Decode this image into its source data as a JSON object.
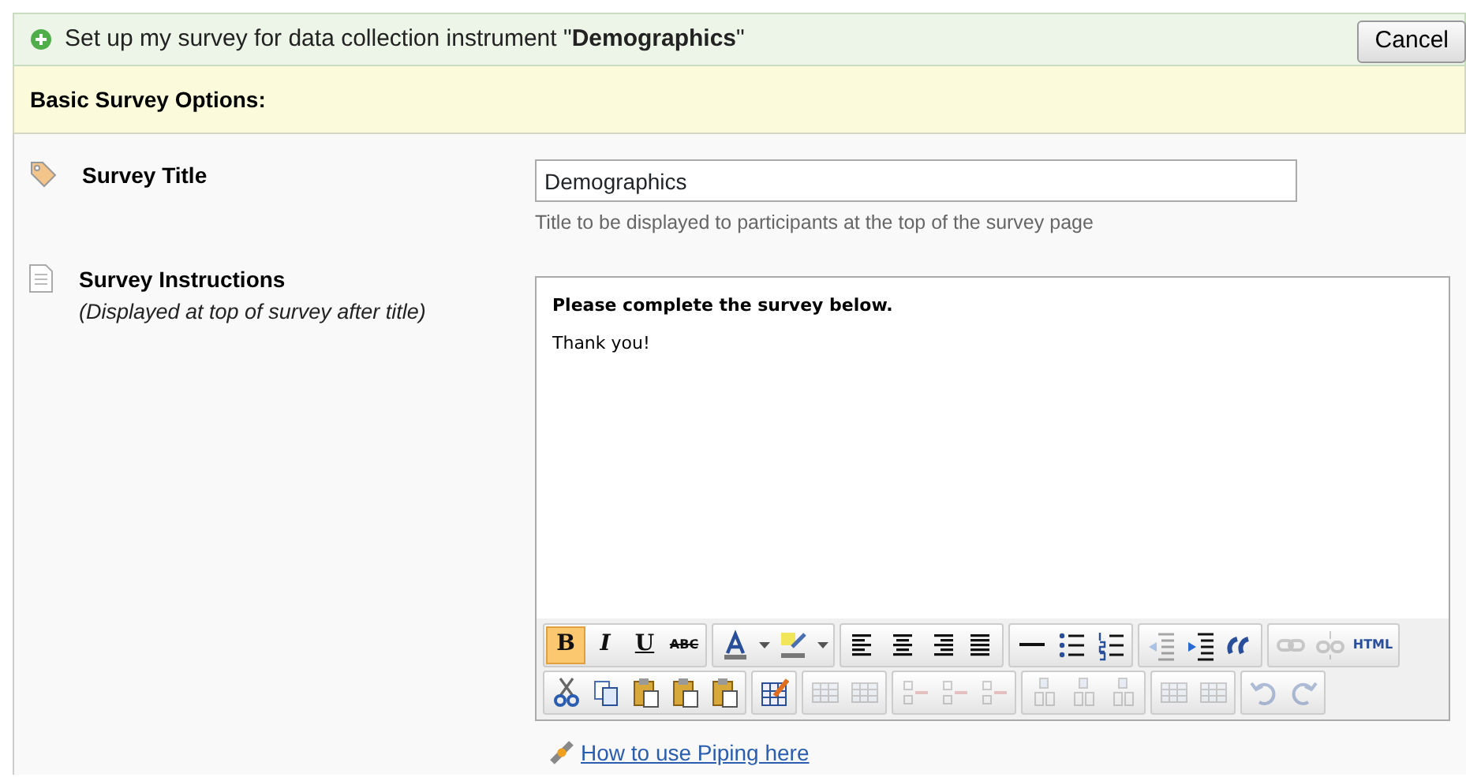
{
  "header": {
    "title": "Set up my survey for data collection instrument \"**Demographics**\"",
    "cancel": "Cancel"
  },
  "section": {
    "title": "Basic Survey Options:"
  },
  "fields": [
    {
      "kind": "text",
      "label": "Survey Title",
      "value": "Demographics",
      "hint": "Title to be displayed to participants at the top of the survey page"
    },
    {
      "kind": "editor",
      "label": "Survey Instructions",
      "sublabel": "(Displayed at top of survey after title)",
      "content": [
        {
          "kind": "heading",
          "text": "Please complete the survey below."
        },
        {
          "kind": "para",
          "text": "Thank you!"
        }
      ],
      "toolbar": [
        [
          [
            {
              "kind": "bold",
              "label": "B",
              "active": true,
              "disabled": false
            },
            {
              "kind": "italic",
              "label": "I",
              "active": false,
              "disabled": false
            },
            {
              "kind": "underline",
              "label": "U",
              "active": false,
              "disabled": false
            },
            {
              "kind": "strike",
              "label": "ABC",
              "active": false,
              "disabled": false
            }
          ],
          [
            {
              "kind": "textcolor",
              "active": false,
              "disabled": false
            },
            {
              "kind": "caret",
              "active": false,
              "disabled": false
            },
            {
              "kind": "highlight",
              "active": false,
              "disabled": false
            },
            {
              "kind": "caret",
              "active": false,
              "disabled": false
            }
          ],
          [
            {
              "kind": "align-left",
              "active": false,
              "disabled": false
            },
            {
              "kind": "align-center",
              "active": false,
              "disabled": false
            },
            {
              "kind": "align-right",
              "active": false,
              "disabled": false
            },
            {
              "kind": "justify",
              "active": false,
              "disabled": false
            }
          ],
          [
            {
              "kind": "rule",
              "active": false,
              "disabled": false
            },
            {
              "kind": "bullets",
              "active": false,
              "disabled": false
            },
            {
              "kind": "numbers",
              "active": false,
              "disabled": false
            }
          ],
          [
            {
              "kind": "outdent",
              "active": false,
              "disabled": true
            },
            {
              "kind": "indent",
              "active": false,
              "disabled": false
            },
            {
              "kind": "quote",
              "active": false,
              "disabled": false
            }
          ],
          [
            {
              "kind": "link",
              "active": false,
              "disabled": true
            },
            {
              "kind": "unlink",
              "active": false,
              "disabled": true
            },
            {
              "kind": "html",
              "label": "HTML",
              "active": false,
              "disabled": false
            }
          ]
        ],
        [
          [
            {
              "kind": "cut",
              "active": false,
              "disabled": false
            },
            {
              "kind": "copy",
              "active": false,
              "disabled": false
            },
            {
              "kind": "paste",
              "active": false,
              "disabled": false
            },
            {
              "kind": "paste",
              "active": false,
              "disabled": false
            },
            {
              "kind": "paste",
              "active": false,
              "disabled": false
            }
          ],
          [
            {
              "kind": "table-edit",
              "active": false,
              "disabled": false
            }
          ],
          [
            {
              "kind": "table",
              "active": false,
              "disabled": true
            },
            {
              "kind": "table",
              "active": false,
              "disabled": true
            }
          ],
          [
            {
              "kind": "row",
              "active": false,
              "disabled": true
            },
            {
              "kind": "row",
              "active": false,
              "disabled": true
            },
            {
              "kind": "row",
              "active": false,
              "disabled": true
            }
          ],
          [
            {
              "kind": "column",
              "active": false,
              "disabled": true
            },
            {
              "kind": "column",
              "active": false,
              "disabled": true
            },
            {
              "kind": "column",
              "active": false,
              "disabled": true
            }
          ],
          [
            {
              "kind": "table",
              "active": false,
              "disabled": true
            },
            {
              "kind": "table",
              "active": false,
              "disabled": true
            }
          ],
          [
            {
              "kind": "undo",
              "active": false,
              "disabled": true
            },
            {
              "kind": "redo",
              "active": false,
              "disabled": true
            }
          ]
        ]
      ]
    }
  ],
  "link": "How to use Piping here"
}
